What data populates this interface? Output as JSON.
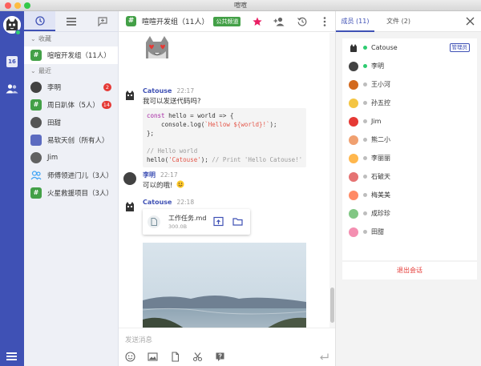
{
  "window": {
    "title": "喧喧"
  },
  "rail": {
    "calendar_day": "16"
  },
  "sidebar": {
    "groups": {
      "favorites": "收藏",
      "recent": "最近"
    },
    "favorites": [
      {
        "name": "喧喧开发组（11人）",
        "avatar_color": "#43a047"
      }
    ],
    "recent": [
      {
        "name": "李明",
        "badge": "2",
        "avatar_color": "#424242"
      },
      {
        "name": "周日趴体（5人）",
        "badge": "14",
        "avatar_color": "#43a047"
      },
      {
        "name": "田甜",
        "badge": "",
        "avatar_color": "#555555"
      },
      {
        "name": "易软天创（所有人）",
        "badge": "",
        "avatar_color": "#5c6bc0"
      },
      {
        "name": "Jim",
        "badge": "",
        "avatar_color": "#616161"
      },
      {
        "name": "师傅领进门儿（3人）",
        "badge": "",
        "avatar_color": "#42a5f5"
      },
      {
        "name": "火星救援项目（3人）",
        "badge": "",
        "avatar_color": "#43a047"
      }
    ]
  },
  "chat": {
    "title": "喧喧开发组（11人）",
    "tag": "公共频道",
    "messages": {
      "m1": {
        "sender": "Catouse",
        "time": "22:17",
        "text": "我可以发送代码吗?"
      },
      "m2": {
        "sender": "李明",
        "time": "22:17",
        "text": "可以的哦!"
      },
      "m3": {
        "sender": "Catouse",
        "time": "22:18"
      }
    },
    "code": {
      "l1a": "const",
      "l1b": " hello = world => {",
      "l2a": "    console.log(",
      "l2b": "`Hellow ${world}!`",
      "l2c": ");",
      "l3": "};",
      "l4": "// Hello world",
      "l5a": "hello(",
      "l5b": "'Catouse'",
      "l5c": "); ",
      "l5d": "// Print 'Hello Catouse!'"
    },
    "file": {
      "name": "工作任务.md",
      "size": "300.0B"
    },
    "composer_placeholder": "发送消息"
  },
  "panel": {
    "tab_members": "成员 (11)",
    "tab_files": "文件 (2)",
    "members": [
      {
        "name": "Catouse",
        "online": true,
        "role": "管理员",
        "color": "#ffffff"
      },
      {
        "name": "李明",
        "online": true,
        "role": "",
        "color": "#424242"
      },
      {
        "name": "王小河",
        "online": false,
        "role": "",
        "color": "#d2691e"
      },
      {
        "name": "孙五控",
        "online": false,
        "role": "",
        "color": "#f4c542"
      },
      {
        "name": "Jim",
        "online": false,
        "role": "",
        "color": "#e53935"
      },
      {
        "name": "熊二小",
        "online": false,
        "role": "",
        "color": "#f0a070"
      },
      {
        "name": "李丽丽",
        "online": false,
        "role": "",
        "color": "#ffb74d"
      },
      {
        "name": "石破天",
        "online": false,
        "role": "",
        "color": "#e57373"
      },
      {
        "name": "梅美美",
        "online": false,
        "role": "",
        "color": "#ff8a65"
      },
      {
        "name": "成珍珍",
        "online": false,
        "role": "",
        "color": "#81c784"
      },
      {
        "name": "田甜",
        "online": false,
        "role": "",
        "color": "#f48fb1"
      }
    ],
    "leave_label": "退出会话"
  },
  "colors": {
    "primary": "#3f51b5",
    "success": "#43a047",
    "danger": "#e53935",
    "accent_star": "#e91e63"
  }
}
